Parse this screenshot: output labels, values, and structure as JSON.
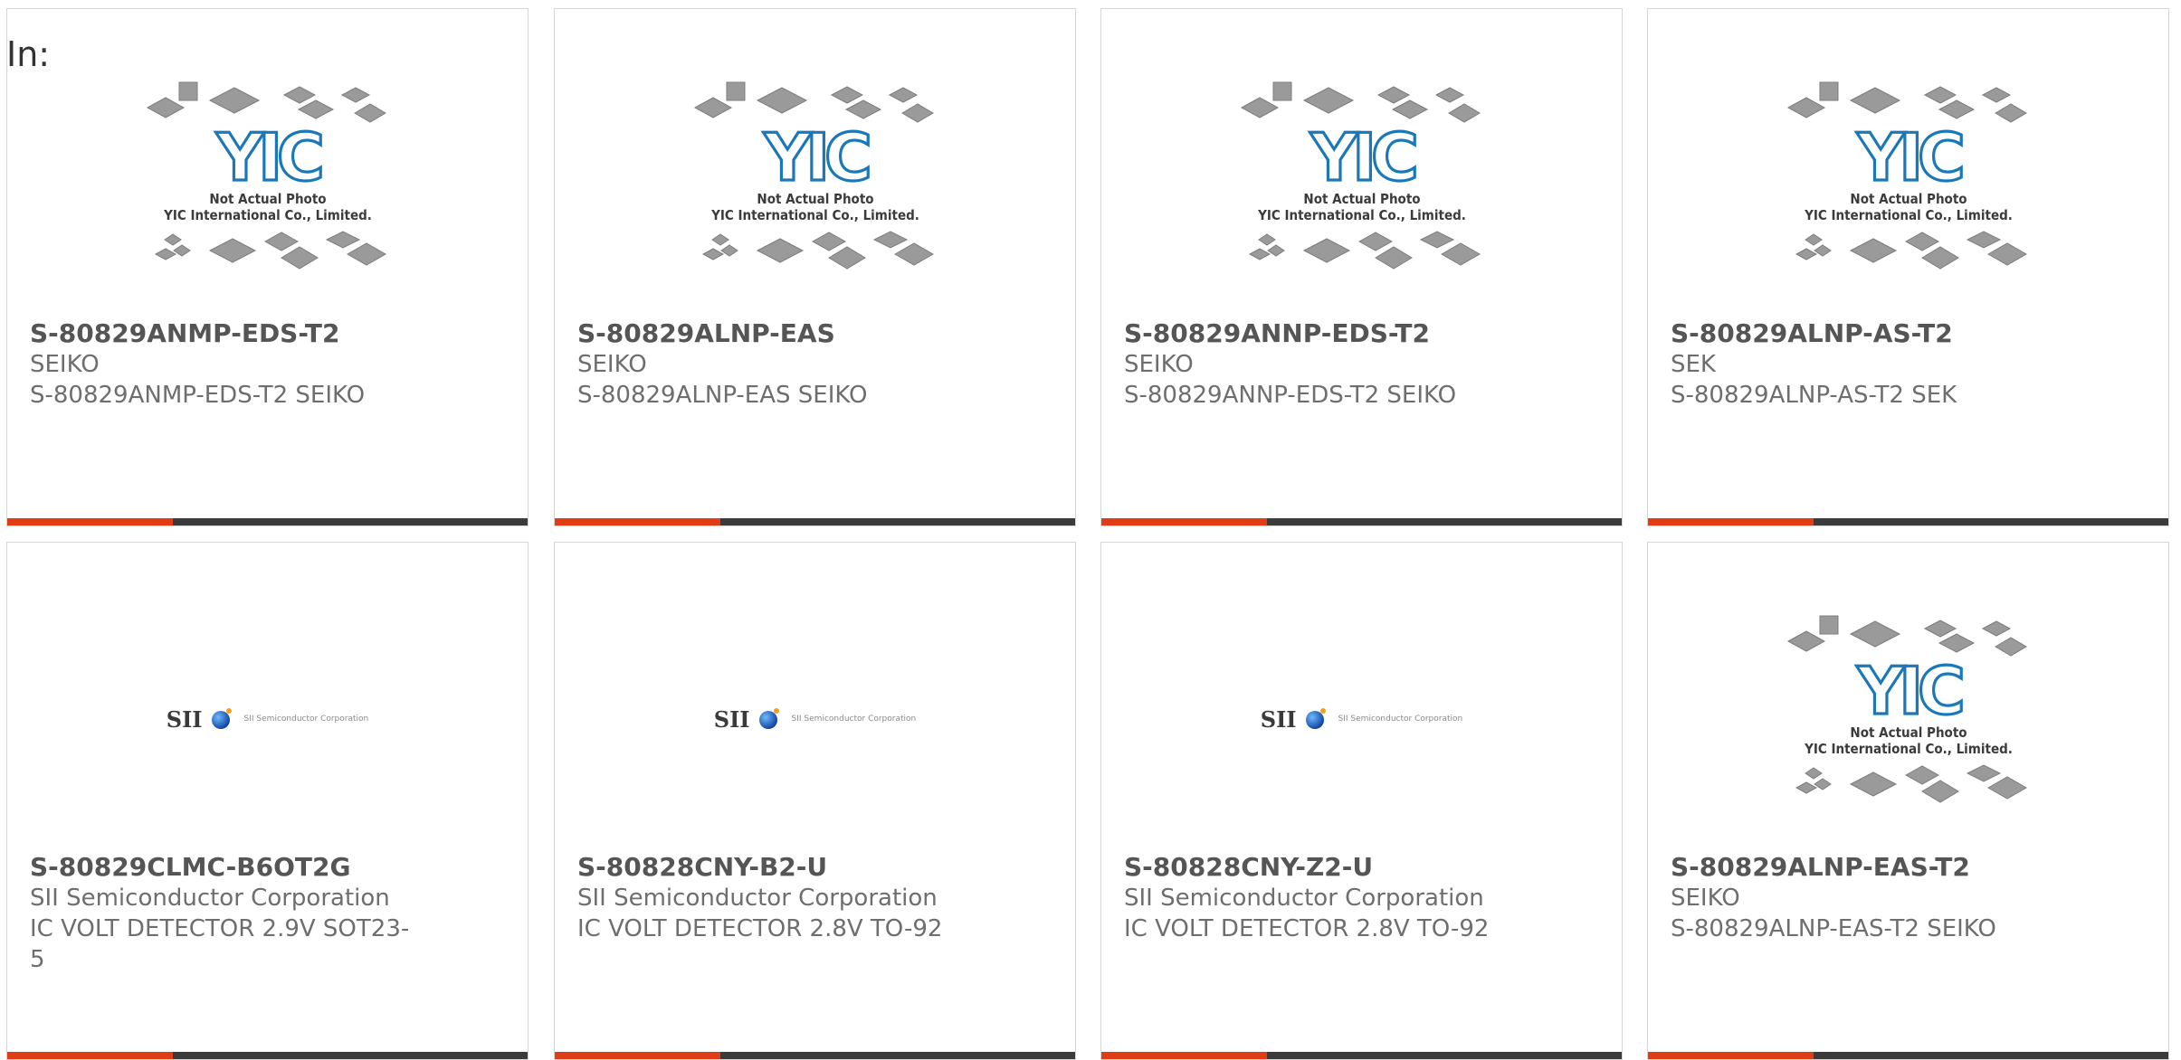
{
  "intro": "In:",
  "products": [
    {
      "part": "S-80829ANMP-EDS-T2",
      "maker": "SEIKO",
      "desc": "S-80829ANMP-EDS-T2 SEIKO",
      "image": "yic-placeholder"
    },
    {
      "part": "S-80829ALNP-EAS",
      "maker": "SEIKO",
      "desc": "S-80829ALNP-EAS SEIKO",
      "image": "yic-placeholder"
    },
    {
      "part": "S-80829ANNP-EDS-T2",
      "maker": "SEIKO",
      "desc": "S-80829ANNP-EDS-T2 SEIKO",
      "image": "yic-placeholder"
    },
    {
      "part": "S-80829ALNP-AS-T2",
      "maker": "SEK",
      "desc": "S-80829ALNP-AS-T2 SEK",
      "image": "yic-placeholder"
    },
    {
      "part": "S-80829CLMC-B6OT2G",
      "maker": "SII Semiconductor Corporation",
      "desc": "IC VOLT DETECTOR 2.9V SOT23-5",
      "image": "sii-logo"
    },
    {
      "part": "S-80828CNY-B2-U",
      "maker": "SII Semiconductor Corporation",
      "desc": "IC VOLT DETECTOR 2.8V TO-92",
      "image": "sii-logo"
    },
    {
      "part": "S-80828CNY-Z2-U",
      "maker": "SII Semiconductor Corporation",
      "desc": "IC VOLT DETECTOR 2.8V TO-92",
      "image": "sii-logo"
    },
    {
      "part": "S-80829ALNP-EAS-T2",
      "maker": "SEIKO",
      "desc": "S-80829ALNP-EAS-T2 SEIKO",
      "image": "yic-placeholder"
    }
  ],
  "placeholder": {
    "logo_text": "YIC",
    "line1": "Not Actual Photo",
    "line2": "YIC International Co., Limited."
  },
  "sii_logo": {
    "mark": "SII",
    "sub": "SII Semiconductor Corporation"
  },
  "colors": {
    "accent": "#e03c16",
    "bar": "#3b3b3b",
    "yic_blue": "#1a78b8",
    "chip_gray": "#9a9a9a"
  }
}
